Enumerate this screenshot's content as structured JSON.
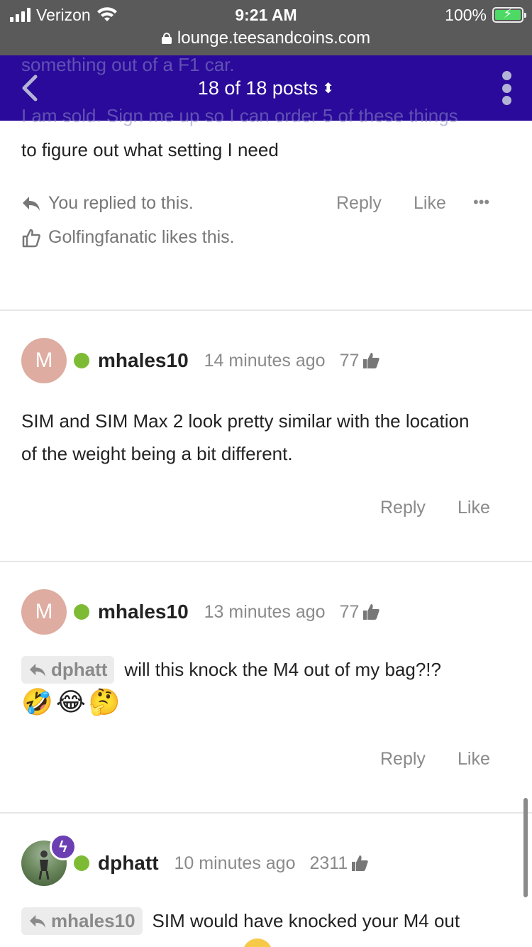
{
  "status_bar": {
    "carrier": "Verizon",
    "time": "9:21 AM",
    "battery": "100%",
    "url": "lounge.teesandcoins.com"
  },
  "header": {
    "title": "18 of 18 posts",
    "sort_glyph": "⬍",
    "behind_text_1": "something out of a F1 car.",
    "behind_text_2": "I am sold. Sign me up so I can order 5 of these things"
  },
  "post1": {
    "text_tail": "to figure out what setting I need",
    "replied_note": "You replied to this.",
    "likes_note": "Golfingfanatic likes this.",
    "reply_label": "Reply",
    "like_label": "Like",
    "more_label": "•••"
  },
  "post2": {
    "avatar_letter": "M",
    "username": "mhales10",
    "time": "14 minutes ago",
    "reputation": "77",
    "text": "SIM and SIM Max 2 look pretty similar with the location of the weight being a bit different.",
    "reply_label": "Reply",
    "like_label": "Like"
  },
  "post3": {
    "avatar_letter": "M",
    "username": "mhales10",
    "time": "13 minutes ago",
    "reputation": "77",
    "quote_user": "dphatt",
    "text": "will this knock the M4 out of my bag?!?",
    "emojis": [
      "🤣",
      "😂",
      "🤔"
    ],
    "reply_label": "Reply",
    "like_label": "Like"
  },
  "post4": {
    "username": "dphatt",
    "time": "10 minutes ago",
    "reputation": "2311",
    "badge_glyph": "ϟ",
    "quote_user": "mhales10",
    "text": "SIM would have knocked your M4 out"
  },
  "colors": {
    "header_bg": "#2a0a9a",
    "status_bg": "#5a5a5a",
    "online": "#7ebb35",
    "avatar_m": "#deaca0",
    "badge": "#6b3fb3"
  }
}
